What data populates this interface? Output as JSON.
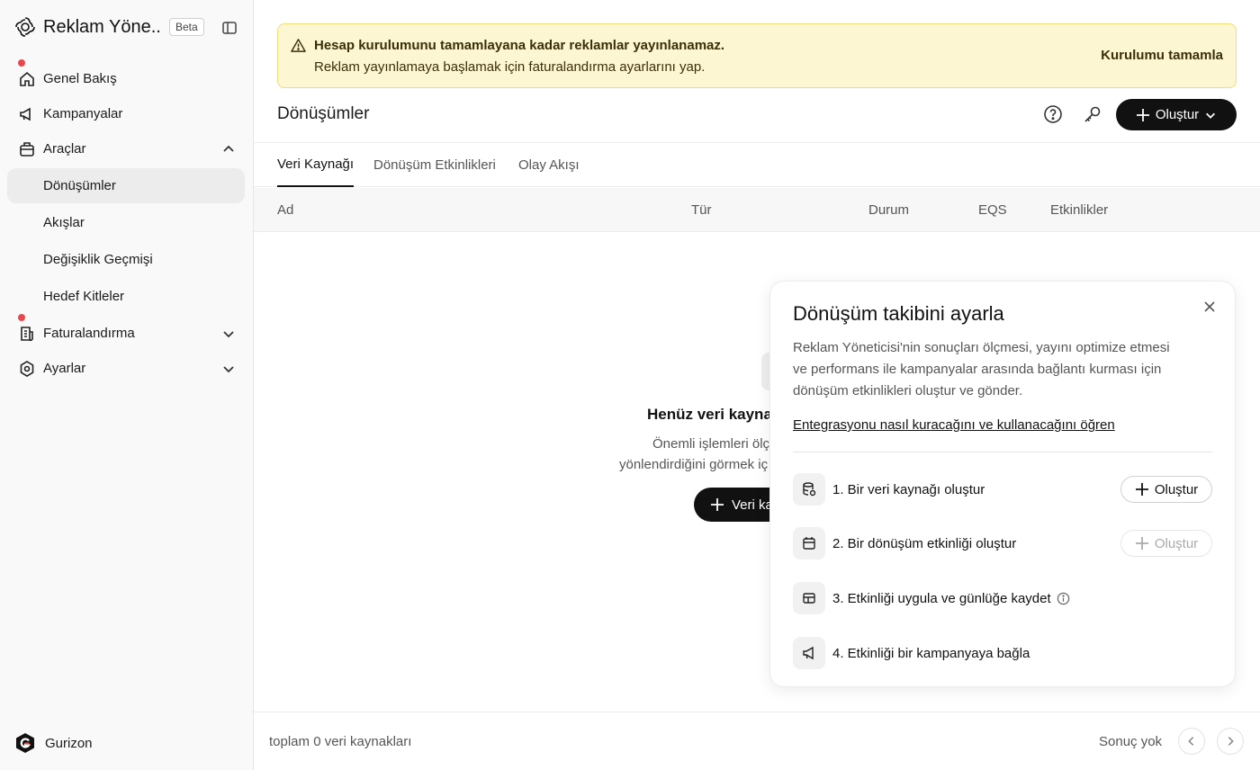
{
  "app": {
    "title": "Reklam Yöne...",
    "beta_label": "Beta"
  },
  "sidebar": {
    "items": [
      {
        "label": "Genel Bakış",
        "icon": "home-icon",
        "has_dot": true
      },
      {
        "label": "Kampanyalar",
        "icon": "megaphone-icon"
      },
      {
        "label": "Araçlar",
        "icon": "tools-icon",
        "expanded": true
      },
      {
        "label": "Dönüşümler",
        "active": true
      },
      {
        "label": "Akışlar"
      },
      {
        "label": "Değişiklik Geçmişi"
      },
      {
        "label": "Hedef Kitleler"
      },
      {
        "label": "Faturalandırma",
        "icon": "billing-icon",
        "has_dot": true
      },
      {
        "label": "Ayarlar",
        "icon": "settings-icon"
      }
    ],
    "org_name": "Gurizon"
  },
  "banner": {
    "title": "Hesap kurulumunu tamamlayana kadar reklamlar yayınlanamaz.",
    "text": "Reklam yayınlamaya başlamak için faturalandırma ayarlarını yap.",
    "action": "Kurulumu tamamla"
  },
  "page": {
    "title": "Dönüşümler",
    "create_label": "Oluştur"
  },
  "tabs": [
    "Veri Kaynağı",
    "Dönüşüm Etkinlikleri",
    "Olay Akışı"
  ],
  "table": {
    "columns": [
      "Ad",
      "Tür",
      "Durum",
      "EQS",
      "Etkinlikler"
    ]
  },
  "empty": {
    "title": "Henüz veri kayna",
    "desc_line1": "Önemli işlemleri ölç",
    "desc_line2": "yönlendirdiğini görmek iç",
    "button": "Veri ka"
  },
  "footer": {
    "total": "toplam 0 veri kaynakları",
    "result": "Sonuç yok"
  },
  "panel": {
    "title": "Dönüşüm takibini ayarla",
    "desc_lines": [
      "Reklam Yöneticisi'nin sonuçları ölçmesi, yayını optimize etmesi",
      "ve performans ile kampanyalar arasında bağlantı kurması için",
      "dönüşüm etkinlikleri oluştur ve gönder."
    ],
    "link": "Entegrasyonu nasıl kuracağını ve kullanacağını öğren",
    "steps": [
      {
        "label": "1. Bir veri kaynağı oluştur",
        "button": "Oluştur",
        "button_enabled": true
      },
      {
        "label": "2. Bir dönüşüm etkinliği oluştur",
        "button": "Oluştur",
        "button_enabled": false
      },
      {
        "label": "3. Etkinliği uygula ve günlüğe kaydet"
      },
      {
        "label": "4. Etkinliği bir kampanyaya bağla"
      }
    ]
  },
  "colors": {
    "accent": "#111111",
    "banner_bg": "#fdf6d3",
    "banner_border": "#f3dc7a",
    "notification_dot": "#e5484d"
  }
}
